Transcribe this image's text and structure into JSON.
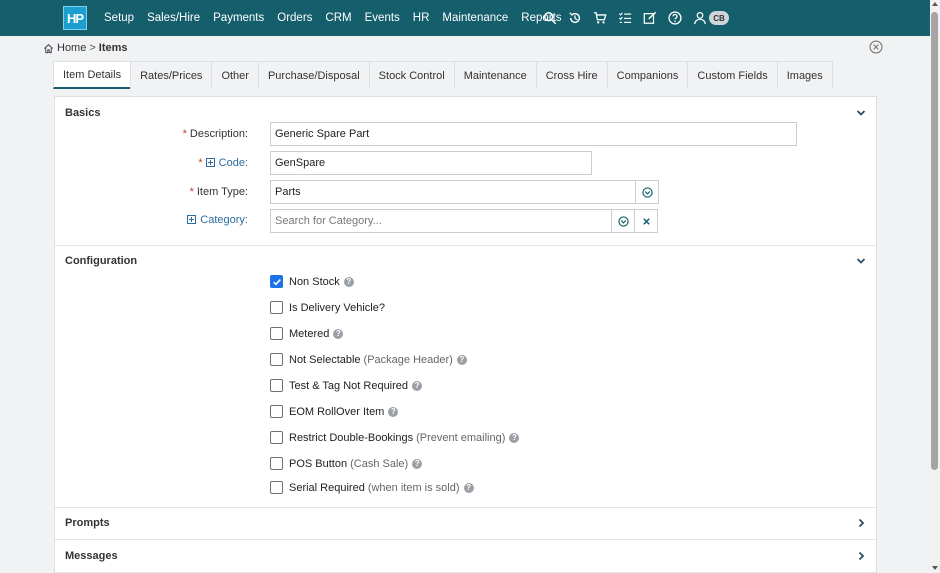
{
  "nav": {
    "logo": "HP",
    "items": [
      "Setup",
      "Sales/Hire",
      "Payments",
      "Orders",
      "CRM",
      "Events",
      "HR",
      "Maintenance",
      "Reports"
    ],
    "icons": [
      "search-icon",
      "history-icon",
      "cart-icon",
      "checklist-icon",
      "edit-icon",
      "help-icon",
      "user-icon"
    ],
    "avatar_initials": "CB",
    "bg_color": "#155e6b"
  },
  "breadcrumb": {
    "home": "Home",
    "separator": ">",
    "current": "Items"
  },
  "tabs": [
    "Item Details",
    "Rates/Prices",
    "Other",
    "Purchase/Disposal",
    "Stock Control",
    "Maintenance",
    "Cross Hire",
    "Companions",
    "Custom Fields",
    "Images"
  ],
  "active_tab": "Item Details",
  "basics": {
    "title": "Basics",
    "description_label": "Description:",
    "description_value": "Generic Spare Part",
    "code_label": "Code:",
    "code_value": "GenSpare",
    "item_type_label": "Item Type:",
    "item_type_value": "Parts",
    "category_label": "Category:",
    "category_placeholder": "Search for Category..."
  },
  "configuration": {
    "title": "Configuration",
    "options": [
      {
        "label": "Non Stock",
        "note": "",
        "checked": true,
        "help": true
      },
      {
        "label": "Is Delivery Vehicle?",
        "note": "",
        "checked": false,
        "help": false
      },
      {
        "label": "Metered",
        "note": "",
        "checked": false,
        "help": true
      },
      {
        "label": "Not Selectable",
        "note": "(Package Header)",
        "checked": false,
        "help": true
      },
      {
        "label": "Test & Tag Not Required",
        "note": "",
        "checked": false,
        "help": true
      },
      {
        "label": "EOM RollOver Item",
        "note": "",
        "checked": false,
        "help": true
      },
      {
        "label": "Restrict Double-Bookings",
        "note": "(Prevent emailing)",
        "checked": false,
        "help": true
      },
      {
        "label": "POS Button",
        "note": "(Cash Sale)",
        "checked": false,
        "help": true
      },
      {
        "label": "Serial Required",
        "note": "(when item is sold)",
        "checked": false,
        "help": true
      }
    ]
  },
  "prompts": {
    "title": "Prompts"
  },
  "messages": {
    "title": "Messages"
  }
}
